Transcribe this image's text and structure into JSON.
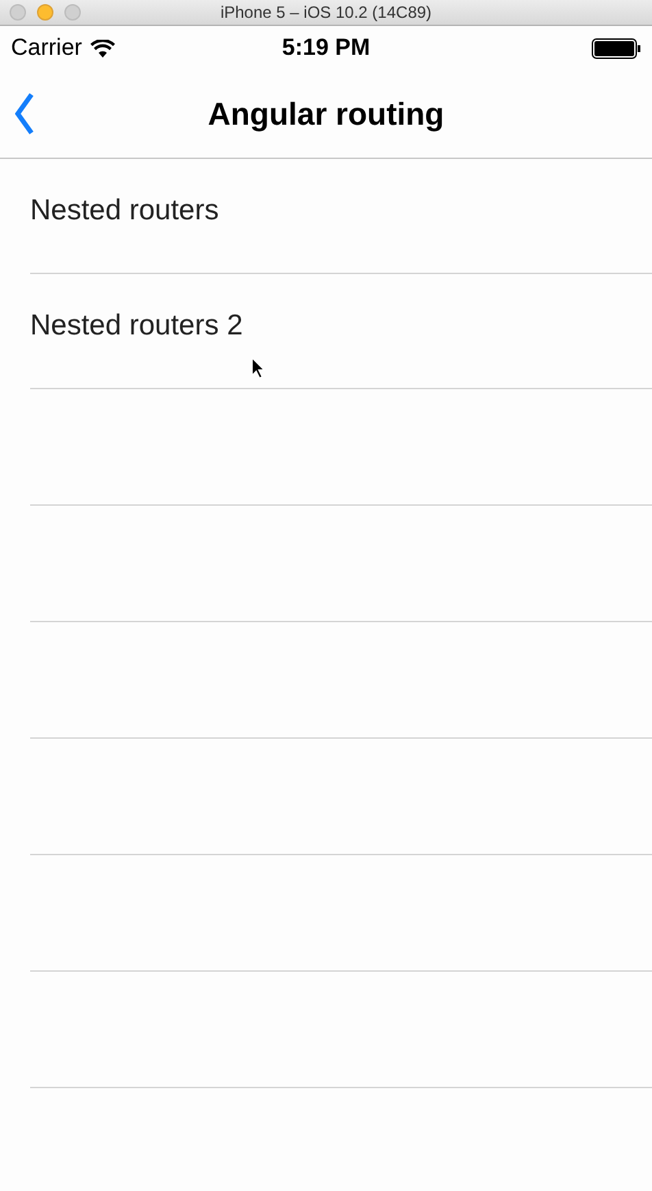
{
  "window": {
    "title": "iPhone 5 – iOS 10.2 (14C89)"
  },
  "status_bar": {
    "carrier": "Carrier",
    "time": "5:19 PM"
  },
  "nav_bar": {
    "title": "Angular routing"
  },
  "list": {
    "items": [
      {
        "label": "Nested routers"
      },
      {
        "label": "Nested routers 2"
      }
    ]
  }
}
